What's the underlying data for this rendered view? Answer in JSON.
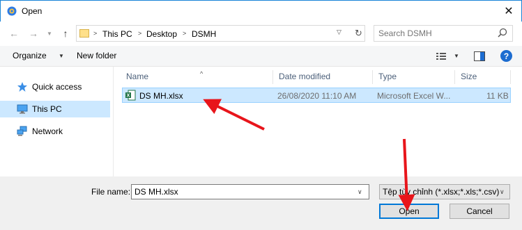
{
  "window": {
    "title": "Open"
  },
  "address": {
    "crumbs": [
      "This PC",
      "Desktop",
      "DSMH"
    ]
  },
  "search": {
    "placeholder": "Search DSMH"
  },
  "toolbar": {
    "organize_label": "Organize",
    "new_folder_label": "New folder"
  },
  "nav": {
    "items": [
      {
        "label": "Quick access",
        "icon": "star-icon"
      },
      {
        "label": "This PC",
        "icon": "computer-icon",
        "selected": true
      },
      {
        "label": "Network",
        "icon": "network-icon"
      }
    ]
  },
  "columns": [
    "Name",
    "Date modified",
    "Type",
    "Size"
  ],
  "files": [
    {
      "name": "DS MH.xlsx",
      "date_modified": "26/08/2020 11:10 AM",
      "type": "Microsoft Excel W...",
      "size": "11 KB",
      "icon": "excel-file-icon",
      "selected": true
    }
  ],
  "bottom": {
    "file_name_label": "File name:",
    "file_name_value": "DS MH.xlsx",
    "filter_value": "Tệp tùy chỉnh (*.xlsx;*.xls;*.csv)",
    "open_label": "Open",
    "cancel_label": "Cancel"
  },
  "colors": {
    "accent": "#0078d7",
    "selection": "#cce8ff",
    "arrow": "#e8151b"
  }
}
